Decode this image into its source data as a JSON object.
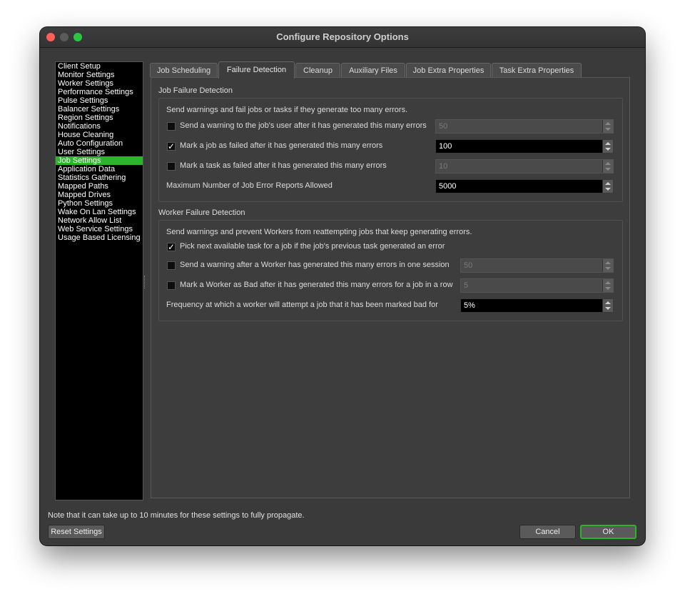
{
  "window": {
    "title": "Configure Repository Options"
  },
  "sidebar": {
    "items": [
      {
        "label": "Client Setup"
      },
      {
        "label": "Monitor Settings"
      },
      {
        "label": "Worker Settings"
      },
      {
        "label": "Performance Settings"
      },
      {
        "label": "Pulse Settings"
      },
      {
        "label": "Balancer Settings"
      },
      {
        "label": "Region Settings"
      },
      {
        "label": "Notifications"
      },
      {
        "label": "House Cleaning"
      },
      {
        "label": "Auto Configuration"
      },
      {
        "label": "User Settings"
      },
      {
        "label": "Job Settings",
        "selected": true
      },
      {
        "label": "Application Data"
      },
      {
        "label": "Statistics Gathering"
      },
      {
        "label": "Mapped Paths"
      },
      {
        "label": "Mapped Drives"
      },
      {
        "label": "Python Settings"
      },
      {
        "label": "Wake On Lan Settings"
      },
      {
        "label": "Network Allow List"
      },
      {
        "label": "Web Service Settings"
      },
      {
        "label": "Usage Based Licensing"
      }
    ],
    "selected_color": "#2bb52b"
  },
  "tabs": [
    {
      "label": "Job Scheduling"
    },
    {
      "label": "Failure Detection",
      "active": true
    },
    {
      "label": "Cleanup"
    },
    {
      "label": "Auxiliary Files"
    },
    {
      "label": "Job Extra Properties"
    },
    {
      "label": "Task Extra Properties"
    }
  ],
  "job_failure": {
    "title": "Job Failure Detection",
    "description": "Send warnings and fail jobs or tasks if they generate too many errors.",
    "rows": [
      {
        "label": "Send a warning to the job's user after it has generated this many errors",
        "checked": false,
        "value": "50",
        "enabled": false
      },
      {
        "label": "Mark a job as failed after it has generated this many errors",
        "checked": true,
        "value": "100",
        "enabled": true
      },
      {
        "label": "Mark a task as failed after it has generated this many errors",
        "checked": false,
        "value": "10",
        "enabled": false
      }
    ],
    "max_reports": {
      "label": "Maximum Number of Job Error Reports Allowed",
      "value": "5000"
    }
  },
  "worker_failure": {
    "title": "Worker Failure Detection",
    "description": "Send warnings and prevent Workers from reattempting jobs that keep generating errors.",
    "pick_next": {
      "label": "Pick next available task for a job if the job's previous task generated an error",
      "checked": true
    },
    "rows": [
      {
        "label": "Send a warning after a Worker has generated this many errors in one session",
        "checked": false,
        "value": "50",
        "enabled": false
      },
      {
        "label": "Mark a Worker as Bad after it has generated this many errors for a job in a row",
        "checked": false,
        "value": "5",
        "enabled": false
      }
    ],
    "frequency": {
      "label": "Frequency at which a worker will attempt a job that it has been marked bad for",
      "value": "5%"
    }
  },
  "footer": {
    "note": "Note that it can take up to 10 minutes for these settings to fully propagate.",
    "reset_label": "Reset Settings",
    "cancel_label": "Cancel",
    "ok_label": "OK"
  },
  "icons": {
    "check_glyph": "✓"
  }
}
